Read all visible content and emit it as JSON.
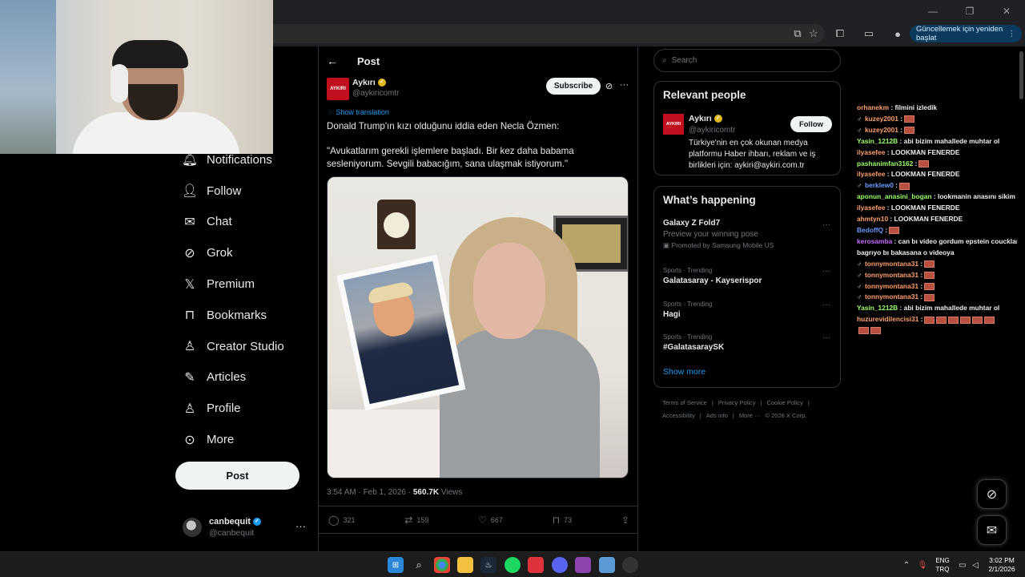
{
  "browser": {
    "update_label": "Güncellemek için yeniden başlat"
  },
  "nav": {
    "items": [
      {
        "label": "Notifications",
        "icon": "bell-icon"
      },
      {
        "label": "Follow",
        "icon": "add-user-icon"
      },
      {
        "label": "Chat",
        "icon": "mail-icon"
      },
      {
        "label": "Grok",
        "icon": "grok-icon"
      },
      {
        "label": "Premium",
        "icon": "x-logo-icon"
      },
      {
        "label": "Bookmarks",
        "icon": "bookmark-icon"
      },
      {
        "label": "Creator Studio",
        "icon": "creator-studio-icon"
      },
      {
        "label": "Articles",
        "icon": "articles-icon"
      },
      {
        "label": "Profile",
        "icon": "profile-icon"
      },
      {
        "label": "More",
        "icon": "more-circle-icon"
      }
    ],
    "post_label": "Post",
    "account": {
      "name": "canbequit",
      "handle": "@canbequit"
    }
  },
  "post": {
    "header_title": "Post",
    "author_name": "Aykırı",
    "author_handle": "@aykiricomtr",
    "logo_text": "AYKIRI",
    "subscribe_label": "Subscribe",
    "show_translation": "Show translation",
    "text_line1": "Donald Trump'ın kızı olduğunu iddia eden Necla Özmen:",
    "text_line2": "\"Avukatlarım gerekli işlemlere başladı. Bir kez daha babama sesleniyorum. Sevgili babacığım, sana ulaşmak istiyorum.\"",
    "timestamp": "3:54 AM · Feb 1, 2026 · ",
    "views_count": "560.7K",
    "views_label": " Views",
    "replies": "321",
    "reposts": "159",
    "likes": "667",
    "bookmarks": "73"
  },
  "sidebar": {
    "search_placeholder": "Search",
    "relevant_title": "Relevant people",
    "relevant": {
      "name": "Aykırı",
      "handle": "@aykiricomtr",
      "logo_text": "AYKIRI",
      "follow_label": "Follow",
      "bio": "Türkiye'nin en çok okunan medya platformu Haber ihbarı, reklam ve iş birlikleri için: aykiri@aykiri.com.tr"
    },
    "happening_title": "What’s happening",
    "promo": {
      "title": "Galaxy Z Fold7",
      "subtitle": "Preview your winning pose",
      "promoted": "Promoted by Samsung Mobile US"
    },
    "trends": [
      {
        "context": "Sports · Trending",
        "title": "Galatasaray - Kayserispor"
      },
      {
        "context": "Sports · Trending",
        "title": "Hagi"
      },
      {
        "context": "Sports · Trending",
        "title": "#GalatasaraySK"
      }
    ],
    "show_more": "Show more",
    "footer": [
      "Terms of Service",
      "|",
      "Privacy Policy",
      "|",
      "Cookie Policy",
      "|",
      "Accessibility",
      "|",
      "Ads info",
      "|",
      "More ···",
      "© 2026 X Corp."
    ]
  },
  "chat": [
    {
      "user": "orhanekm",
      "color": "#ff9f6b",
      "msg": " : filmini izledik",
      "emotes": 0,
      "badge": false
    },
    {
      "user": "kuzey2001",
      "color": "#ff9f6b",
      "msg": " :",
      "emotes": 1,
      "badge": true
    },
    {
      "user": "kuzey2001",
      "color": "#ff9f6b",
      "msg": " :",
      "emotes": 1,
      "badge": true
    },
    {
      "user": "Yasin_1212B",
      "color": "#9aff6b",
      "msg": " : abi bizim mahallede muhtar ol",
      "emotes": 0,
      "badge": false
    },
    {
      "user": "ilyasefee",
      "color": "#ff9f6b",
      "msg": " : LOOKMAN FENERDE",
      "emotes": 0,
      "badge": false
    },
    {
      "user": "pashanimfan3162",
      "color": "#9aff6b",
      "msg": " :",
      "emotes": 1,
      "badge": false
    },
    {
      "user": "ilyasefee",
      "color": "#ff9f6b",
      "msg": " : LOOKMAN FENERDE",
      "emotes": 0,
      "badge": false
    },
    {
      "user": "berklew0",
      "color": "#6b9bff",
      "msg": " :",
      "emotes": 1,
      "badge": true
    },
    {
      "user": "aponun_anasini_bogan",
      "color": "#9aff6b",
      "msg": " : lookmanin anasını sikim",
      "emotes": 0,
      "badge": false
    },
    {
      "user": "ilyasefee",
      "color": "#ff9f6b",
      "msg": " : LOOKMAN FENERDE",
      "emotes": 0,
      "badge": false
    },
    {
      "user": "ahmtyn10",
      "color": "#ff9f6b",
      "msg": " : LOOKMAN FENERDE",
      "emotes": 0,
      "badge": false
    },
    {
      "user": "BedoffQ",
      "color": "#6b9bff",
      "msg": " :",
      "emotes": 1,
      "badge": false
    },
    {
      "user": "kerosamba",
      "color": "#c86bff",
      "msg": " : can bı video gordum epstein coucklar",
      "emotes": 0,
      "badge": false
    },
    {
      "user": "",
      "color": "#efeff1",
      "msg": "bagrıyo bı bakasana o videoya",
      "emotes": 0,
      "badge": false
    },
    {
      "user": "tonnymontana31",
      "color": "#ff9f6b",
      "msg": " :",
      "emotes": 1,
      "badge": true
    },
    {
      "user": "tonnymontana31",
      "color": "#ff9f6b",
      "msg": " :",
      "emotes": 1,
      "badge": true
    },
    {
      "user": "tonnymontana31",
      "color": "#ff9f6b",
      "msg": " :",
      "emotes": 1,
      "badge": true
    },
    {
      "user": "tonnymontana31",
      "color": "#ff9f6b",
      "msg": " :",
      "emotes": 1,
      "badge": true
    },
    {
      "user": "Yasin_1212B",
      "color": "#9aff6b",
      "msg": " : abi bizim mahallede muhtar ol",
      "emotes": 0,
      "badge": false
    },
    {
      "user": "huzurevidilencisi31",
      "color": "#ff9f6b",
      "msg": " :",
      "emotes": 6,
      "badge": false
    },
    {
      "user": "",
      "color": "#efeff1",
      "msg": "",
      "emotes": 2,
      "badge": false
    }
  ],
  "taskbar": {
    "lang_line1": "ENG",
    "lang_line2": "TRQ",
    "time": "3:02 PM",
    "date": "2/1/2026"
  }
}
